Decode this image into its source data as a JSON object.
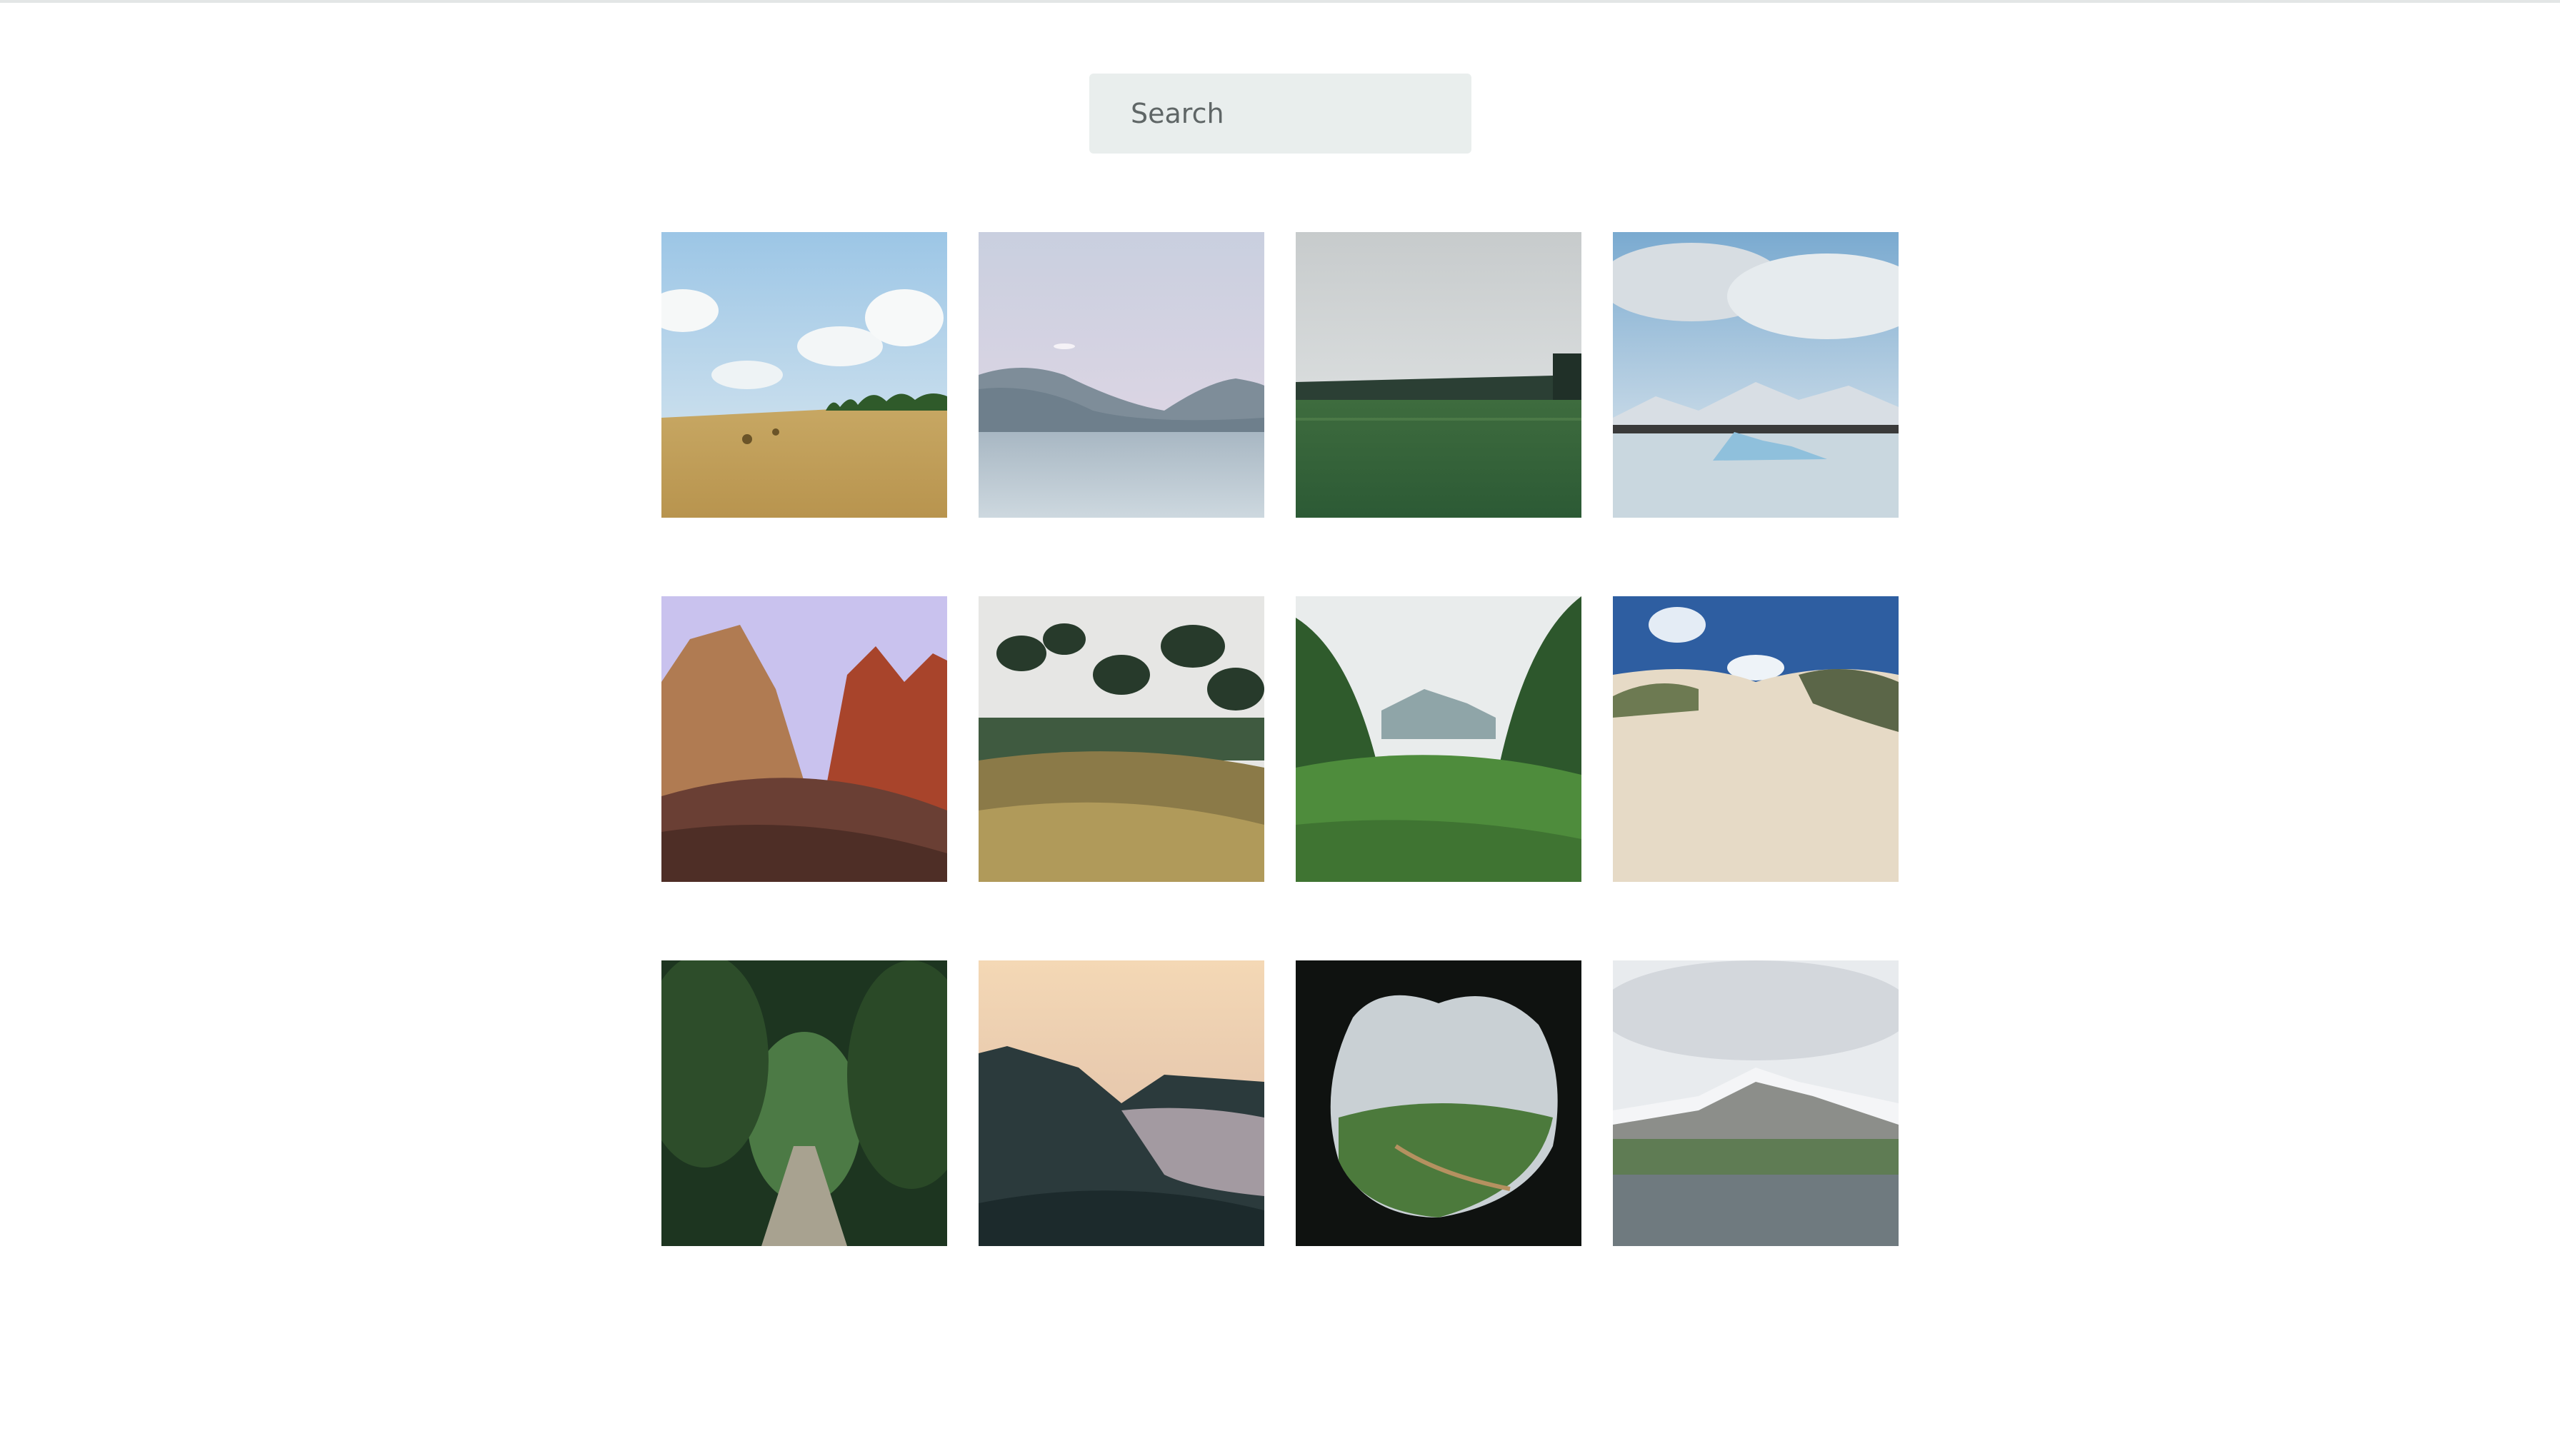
{
  "search": {
    "placeholder": "Search"
  },
  "gallery": {
    "photos": [
      {
        "subject": "golden-field-under-cloudy-sky"
      },
      {
        "subject": "calm-lake-with-mountains"
      },
      {
        "subject": "green-field-overcast"
      },
      {
        "subject": "icebergs-glacier-lagoon"
      },
      {
        "subject": "red-rock-canyon-cliffs"
      },
      {
        "subject": "garden-with-pine-trees"
      },
      {
        "subject": "jungle-valley-grass"
      },
      {
        "subject": "sand-dunes-with-grass"
      },
      {
        "subject": "forest-path-tunnel"
      },
      {
        "subject": "coast-at-sunset"
      },
      {
        "subject": "cave-opening-view-valley"
      },
      {
        "subject": "lupine-meadow-snowy-mountain"
      }
    ]
  }
}
